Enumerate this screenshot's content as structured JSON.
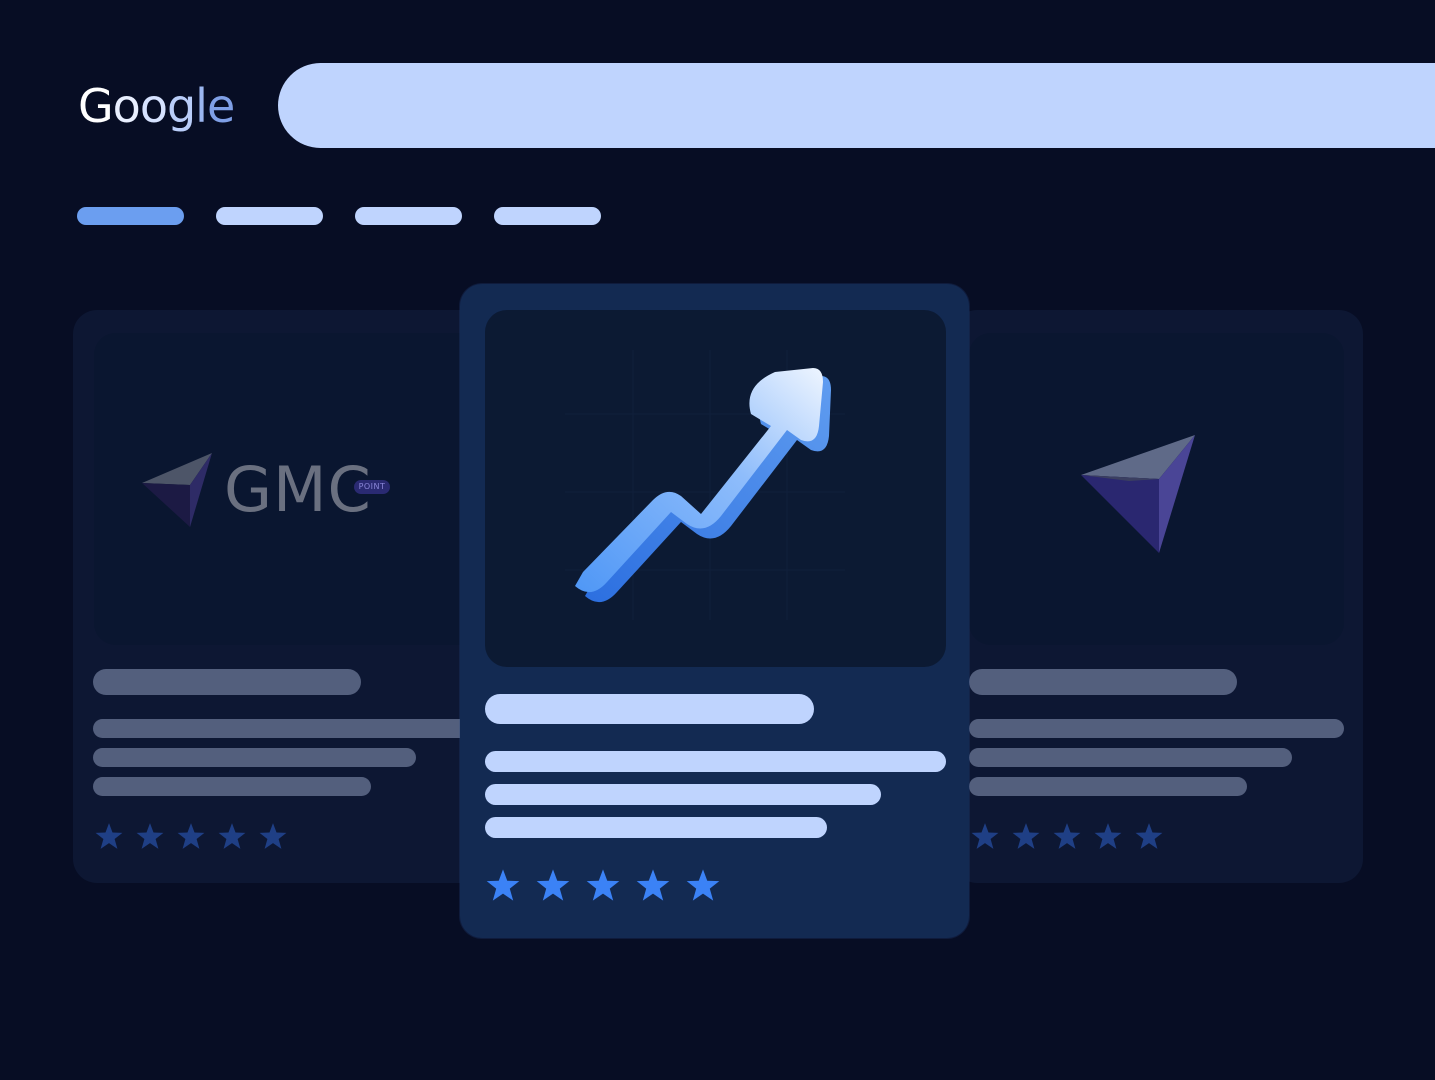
{
  "logo": {
    "letters": [
      "G",
      "o",
      "o",
      "g",
      "l",
      "e"
    ]
  },
  "search": {
    "value": ""
  },
  "tabs": [
    {
      "label": "",
      "active": true
    },
    {
      "label": "",
      "active": false
    },
    {
      "label": "",
      "active": false
    },
    {
      "label": "",
      "active": false
    }
  ],
  "cards": {
    "left": {
      "brand_text": "GMC",
      "brand_badge": "POINT",
      "stars": 5
    },
    "center": {
      "stars": 5,
      "icon": "trending-up-arrow-icon"
    },
    "right": {
      "stars": 5,
      "icon": "navigation-arrow-icon"
    }
  },
  "colors": {
    "background": "#070d24",
    "search_bar": "#bfd4fe",
    "tab_active": "#6b9ef0",
    "tab_inactive": "#bfd4fe",
    "card_side": "#0d1733",
    "card_center": "#132a52",
    "star_side": "#1f3f85",
    "star_center": "#3b82f6"
  }
}
